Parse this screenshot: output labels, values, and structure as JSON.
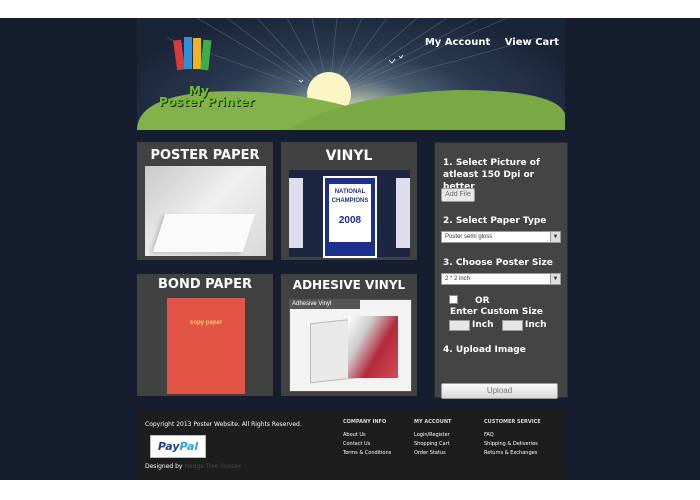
{
  "header": {
    "logo_line1": "My",
    "logo_line2": "Poster Printer",
    "nav": [
      "My Account",
      "View Cart"
    ]
  },
  "products": [
    {
      "title": "POSTER PAPER"
    },
    {
      "title": "VINYL",
      "image_text": {
        "line1": "NATIONAL",
        "line2": "CHAMPIONS",
        "year": "2008"
      }
    },
    {
      "title": "BOND PAPER",
      "image_text": "copy paper"
    },
    {
      "title": "ADHESIVE VINYL",
      "image_text": "Adhesive Vinyl"
    }
  ],
  "order_form": {
    "step1": "1. Select Picture of atleast 150 Dpi or better",
    "add_file": "Add File",
    "step2": "2. Select Paper Type",
    "paper_type_value": "Poster semi gloss",
    "step3": "3. Choose Poster Size",
    "poster_size_value": "2 * 2 inch",
    "or_label": "OR",
    "custom_size_label": "Enter Custom Size",
    "inch_label": "Inch",
    "step4": "4. Upload Image",
    "upload_button": "Upload"
  },
  "footer": {
    "copyright": "Copyright 2013 Poster Website. All Rights Reserved.",
    "paypal_part1": "Pay",
    "paypal_part2": "Pal",
    "designed_by": "Designed by",
    "designer": "Hedge Tree Sussex",
    "columns": [
      {
        "heading": "COMPANY INFO",
        "links": [
          "About Us",
          "Contact Us",
          "Terms & Conditions"
        ]
      },
      {
        "heading": "MY ACCOUNT",
        "links": [
          "Login/Register",
          "Shopping Cart",
          "Order Status"
        ]
      },
      {
        "heading": "CUSTOMER SERVICE",
        "links": [
          "FAQ",
          "Shipping & Deliveries",
          "Returns & Exchanges"
        ]
      }
    ]
  },
  "colors": {
    "page_bg": "#161d2e",
    "tile_bg": "#414141",
    "logo_green": "#6fbf2a",
    "grass_green": "#84b24a"
  },
  "icons": [
    "logo-books-icon",
    "bird-icon",
    "sun-icon",
    "dropdown-arrow-icon"
  ]
}
